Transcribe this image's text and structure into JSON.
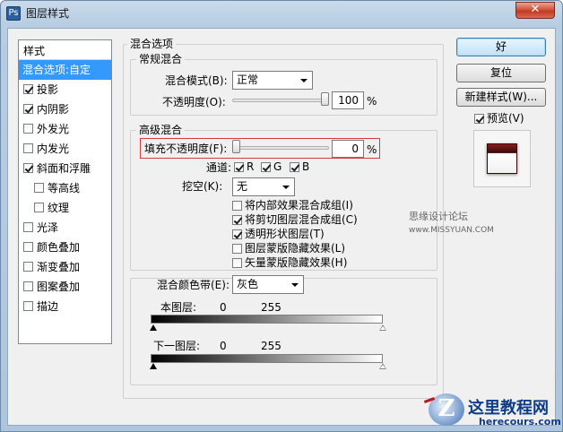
{
  "window": {
    "title": "图层样式",
    "close_label": "✕",
    "app_icon": "ps-icon"
  },
  "styles_list": {
    "header": "样式",
    "items": [
      {
        "label": "混合选项:自定",
        "checked": null,
        "selected": true,
        "indent": false
      },
      {
        "label": "投影",
        "checked": true,
        "indent": false
      },
      {
        "label": "内阴影",
        "checked": true,
        "indent": false
      },
      {
        "label": "外发光",
        "checked": false,
        "indent": false
      },
      {
        "label": "内发光",
        "checked": false,
        "indent": false
      },
      {
        "label": "斜面和浮雕",
        "checked": true,
        "indent": false
      },
      {
        "label": "等高线",
        "checked": false,
        "indent": true
      },
      {
        "label": "纹理",
        "checked": false,
        "indent": true
      },
      {
        "label": "光泽",
        "checked": false,
        "indent": false
      },
      {
        "label": "颜色叠加",
        "checked": false,
        "indent": false
      },
      {
        "label": "渐变叠加",
        "checked": false,
        "indent": false
      },
      {
        "label": "图案叠加",
        "checked": false,
        "indent": false
      },
      {
        "label": "描边",
        "checked": false,
        "indent": false
      }
    ]
  },
  "blend_options": {
    "title": "混合选项",
    "general": {
      "title": "常规混合",
      "mode_label": "混合模式(B):",
      "mode_value": "正常",
      "opacity_label": "不透明度(O):",
      "opacity_value": "100",
      "opacity_unit": "%",
      "opacity_fraction": 1.0
    },
    "advanced": {
      "title": "高级混合",
      "fill_label": "填充不透明度(F):",
      "fill_value": "0",
      "fill_unit": "%",
      "fill_fraction": 0.0,
      "channels_label": "通道:",
      "channels": [
        {
          "label": "R",
          "checked": true
        },
        {
          "label": "G",
          "checked": true
        },
        {
          "label": "B",
          "checked": true
        }
      ],
      "knockout_label": "挖空(K):",
      "knockout_value": "无",
      "options": [
        {
          "label": "将内部效果混合成组(I)",
          "checked": false
        },
        {
          "label": "将剪切图层混合成组(C)",
          "checked": true
        },
        {
          "label": "透明形状图层(T)",
          "checked": true
        },
        {
          "label": "图层蒙版隐藏效果(L)",
          "checked": false
        },
        {
          "label": "矢量蒙版隐藏效果(H)",
          "checked": false
        }
      ]
    },
    "blend_if": {
      "label": "混合颜色带(E):",
      "value": "灰色",
      "this_layer_label": "本图层:",
      "this_layer_low": "0",
      "this_layer_high": "255",
      "underlying_label": "下一图层:",
      "underlying_low": "0",
      "underlying_high": "255"
    }
  },
  "buttons": {
    "ok": "好",
    "reset": "复位",
    "new_style": "新建样式(W)...",
    "preview_label": "预览(V)",
    "preview_checked": true
  },
  "watermark": {
    "text": "思缘设计论坛",
    "url": "www.MISSYUAN.COM"
  },
  "site_logo": {
    "letter": "Z",
    "name": "这里教程网",
    "url": "herecours.com"
  },
  "colors": {
    "selection": "#3399ff",
    "highlight_border": "#d73a3a",
    "title_gradient": "#b7cde2"
  }
}
